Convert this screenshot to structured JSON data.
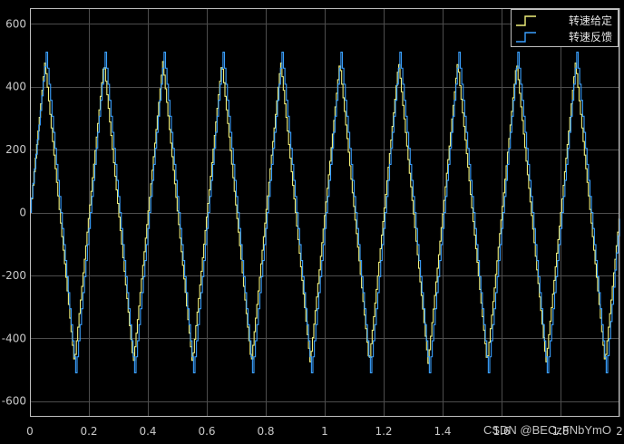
{
  "chart_data": {
    "type": "line",
    "xlim": [
      0,
      2
    ],
    "ylim": [
      -650,
      650
    ],
    "x_ticks": [
      0,
      0.2,
      0.4,
      0.6,
      0.8,
      1,
      1.2,
      1.4,
      1.6,
      1.8,
      2
    ],
    "y_ticks": [
      -600,
      -400,
      -200,
      0,
      200,
      400,
      600
    ],
    "x_tick_labels": [
      "0",
      "0.2",
      "0.4",
      "0.6",
      "0.8",
      "1",
      "1.2",
      "1.4",
      "1.6",
      "1.8",
      "2"
    ],
    "y_tick_labels": [
      "-600",
      "-400",
      "-200",
      "0",
      "200",
      "400",
      "600"
    ],
    "grid": true,
    "legend_position": "top-right",
    "series": [
      {
        "name": "转速给定",
        "color": "#f0f07a",
        "x": [
          0,
          0.05,
          0.15,
          0.25,
          0.35,
          0.45,
          0.55,
          0.65,
          0.75,
          0.85,
          0.95,
          1.05,
          1.15,
          1.25,
          1.35,
          1.45,
          1.55,
          1.65,
          1.75,
          1.85,
          1.95,
          2.0
        ],
        "y": [
          0,
          480,
          -480,
          480,
          -480,
          480,
          -480,
          480,
          -480,
          480,
          -480,
          480,
          -480,
          480,
          -480,
          480,
          -480,
          480,
          -480,
          480,
          -480,
          0
        ]
      },
      {
        "name": "转速反馈",
        "color": "#3aa0ff",
        "x": [
          0,
          0.055,
          0.155,
          0.255,
          0.355,
          0.455,
          0.555,
          0.655,
          0.755,
          0.855,
          0.955,
          1.055,
          1.155,
          1.255,
          1.355,
          1.455,
          1.555,
          1.655,
          1.755,
          1.855,
          1.955,
          2.0
        ],
        "y": [
          0,
          510,
          -510,
          510,
          -510,
          510,
          -510,
          510,
          -510,
          510,
          -510,
          510,
          -510,
          510,
          -510,
          510,
          -510,
          510,
          -510,
          510,
          -510,
          -20
        ]
      }
    ]
  },
  "watermark": "CSDN @BECzFNbYmO"
}
